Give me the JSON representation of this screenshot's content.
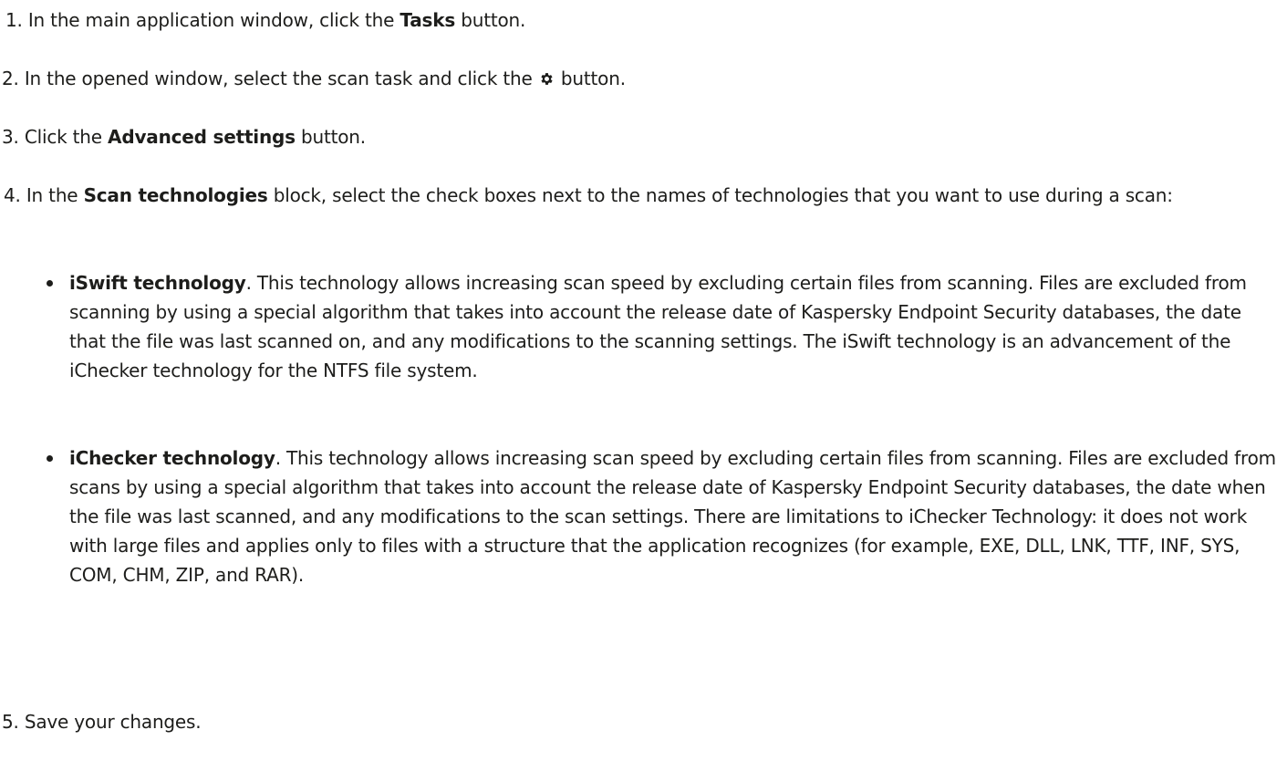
{
  "steps": [
    {
      "num": "1.",
      "pre": " In the main application window, click the ",
      "bold": "Tasks",
      "post": " button."
    },
    {
      "num": "2.",
      "pre": " In the opened window, select the scan task and click the ",
      "icon": "gear-icon",
      "post": " button."
    },
    {
      "num": "3.",
      "pre": " Click the ",
      "bold": "Advanced settings",
      "post": " button."
    },
    {
      "num": "4.",
      "pre": " In the ",
      "bold": "Scan technologies",
      "post": " block, select the check boxes next to the names of technologies that you want to use during a scan:"
    },
    {
      "num": "5.",
      "pre": " Save your changes."
    }
  ],
  "bullets": [
    {
      "bold": "iSwift technology",
      "text": ". This technology allows increasing scan speed by excluding certain files from scanning. Files are excluded from scanning by using a special algorithm that takes into account the release date of Kaspersky Endpoint Security databases, the date that the file was last scanned on, and any modifications to the scanning settings. The iSwift technology is an advancement of the iChecker technology for the NTFS file system."
    },
    {
      "bold": "iChecker technology",
      "text": ". This technology allows increasing scan speed by excluding certain files from scanning. Files are excluded from scans by using a special algorithm that takes into account the release date of Kaspersky Endpoint Security databases, the date when the file was last scanned, and any modifications to the scan settings. There are limitations to iChecker Technology: it does not work with large files and applies only to files with a structure that the application recognizes (for example, EXE, DLL, LNK, TTF, INF, SYS, COM, CHM, ZIP, and RAR)."
    }
  ]
}
